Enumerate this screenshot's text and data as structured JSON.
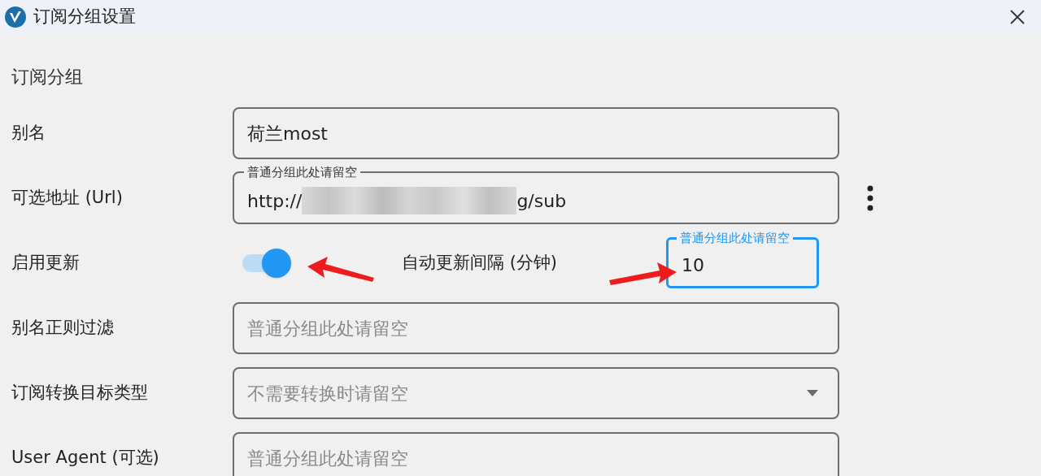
{
  "window": {
    "title": "订阅分组设置"
  },
  "section": "订阅分组",
  "rows": [
    {
      "kind": "text",
      "label": "别名",
      "value": "荷兰most"
    },
    {
      "kind": "url",
      "label": "可选地址 (Url)",
      "floating_label": "普通分组此处请留空",
      "value_start": "http://",
      "value_end": "g/sub"
    },
    {
      "kind": "toggle",
      "label": "启用更新",
      "on": true,
      "interval_label": "自动更新间隔 (分钟)",
      "interval": {
        "floating_label": "普通分组此处请留空",
        "value": "10",
        "focused": true
      }
    },
    {
      "kind": "text",
      "label": "别名正则过滤",
      "placeholder": "普通分组此处请留空"
    },
    {
      "kind": "select",
      "label": "订阅转换目标类型",
      "placeholder": "不需要转换时请留空"
    },
    {
      "kind": "text",
      "label": "User Agent (可选)",
      "placeholder": "普通分组此处请留空"
    }
  ]
}
